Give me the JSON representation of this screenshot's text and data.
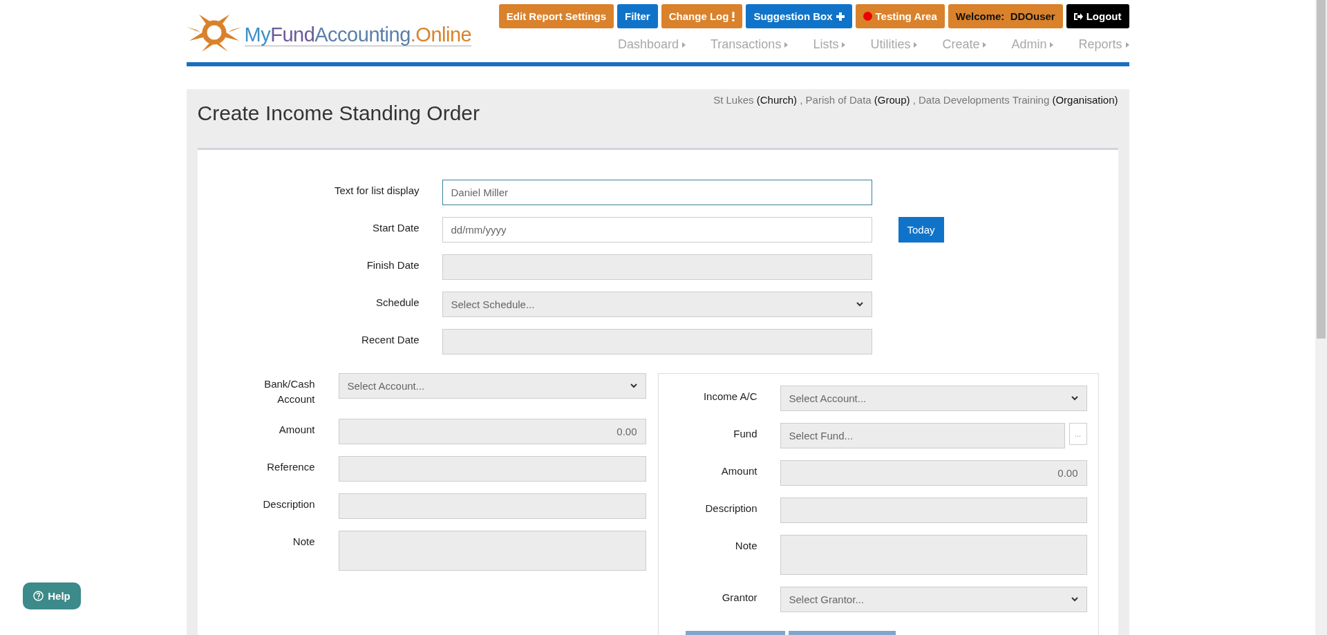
{
  "header": {
    "logo_parts": [
      {
        "text": "My",
        "color": "#3f8fc9"
      },
      {
        "text": "Fund",
        "color": "#6a5a9a"
      },
      {
        "text": "Accounting",
        "color": "#5a7fa8"
      },
      {
        "text": ".Online",
        "color": "#d9822b"
      }
    ],
    "buttons": [
      {
        "label": "Edit Report Settings",
        "kind": "orange"
      },
      {
        "label": "Filter",
        "kind": "blue"
      },
      {
        "label": "Change Log",
        "kind": "orange"
      },
      {
        "label": "Suggestion Box",
        "kind": "blue"
      },
      {
        "label": "Testing Area",
        "kind": "orange"
      },
      {
        "label": "Welcome:  DDOuser",
        "kind": "user"
      },
      {
        "label": "Logout",
        "kind": "black"
      }
    ],
    "nav": [
      "Dashboard",
      "Transactions",
      "Lists",
      "Utilities",
      "Create",
      "Admin",
      "Reports"
    ]
  },
  "page": {
    "title": "Create Income Standing Order",
    "context": [
      {
        "name": "St Lukes",
        "type": "(Church)"
      },
      {
        "name": "Parish of Data",
        "type": "(Group)"
      },
      {
        "name": "Data Developments Training",
        "type": "(Organisation)"
      }
    ],
    "context_separator": ",",
    "top_fields": [
      {
        "label": "Text for list display",
        "kind": "input",
        "value": "Daniel Miller",
        "disabled": false,
        "focused": true
      },
      {
        "label": "Start Date",
        "kind": "input",
        "placeholder": "dd/mm/yyyy",
        "disabled": false,
        "focused": false,
        "button": "Today"
      },
      {
        "label": "Finish Date",
        "kind": "input",
        "disabled": true,
        "focused": false
      },
      {
        "label": "Schedule",
        "kind": "select",
        "value": "Select Schedule...",
        "disabled": true,
        "focused": false
      },
      {
        "label": "Recent Date",
        "kind": "input",
        "disabled": true,
        "focused": false
      }
    ],
    "left_fields": [
      {
        "label": "Bank/Cash Account",
        "kind": "select",
        "value": "Select Account...",
        "disabled": true
      },
      {
        "label": "Amount",
        "kind": "number",
        "value": "0.00",
        "disabled": true
      },
      {
        "label": "Reference",
        "kind": "input",
        "disabled": true
      },
      {
        "label": "Description",
        "kind": "input",
        "disabled": true
      },
      {
        "label": "Note",
        "kind": "textarea",
        "disabled": true
      }
    ],
    "right_fields": [
      {
        "label": "Income A/C",
        "kind": "select",
        "value": "Select Account...",
        "disabled": true
      },
      {
        "label": "Fund",
        "kind": "input",
        "placeholder": "Select Fund...",
        "disabled": true,
        "button": "..."
      },
      {
        "label": "Amount",
        "kind": "number",
        "value": "0.00",
        "disabled": true
      },
      {
        "label": "Description",
        "kind": "input",
        "disabled": true
      },
      {
        "label": "Note",
        "kind": "textarea",
        "disabled": true
      },
      {
        "label": "Grantor",
        "kind": "select",
        "value": "Select Grantor...",
        "disabled": true
      }
    ],
    "actions": [
      {
        "kind": "primary"
      },
      {
        "kind": "primary"
      }
    ]
  },
  "help": {
    "label": "Help"
  }
}
